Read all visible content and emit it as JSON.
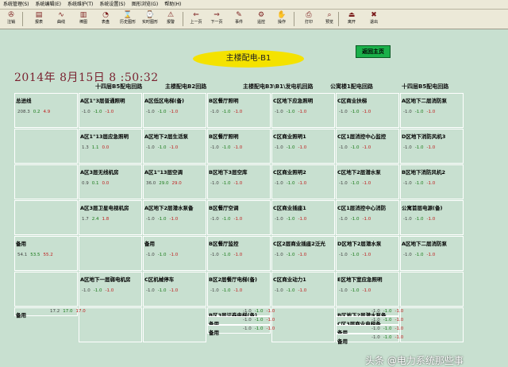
{
  "menu": [
    "系统管理(S)",
    "系统编辑(E)",
    "系统维护(T)",
    "系统设置(S)",
    "图形浏览(G)",
    "帮助(H)"
  ],
  "toolbar": [
    {
      "label": "注销",
      "icon": "logout-icon",
      "glyph": "✇"
    },
    {
      "label": "报表",
      "icon": "report-icon",
      "glyph": "▤"
    },
    {
      "label": "曲线",
      "icon": "curve-icon",
      "glyph": "∿"
    },
    {
      "label": "棒图",
      "icon": "bar-chart-icon",
      "glyph": "▥"
    },
    {
      "label": "表盘",
      "icon": "dial-icon",
      "glyph": "◔"
    },
    {
      "label": "历史图形",
      "icon": "history-graph-icon",
      "glyph": "⌛"
    },
    {
      "label": "实时图形",
      "icon": "realtime-graph-icon",
      "glyph": "⌚"
    },
    {
      "label": "报警",
      "icon": "alarm-icon",
      "glyph": "⚠"
    },
    {
      "label": "上一页",
      "icon": "prev-page-icon",
      "glyph": "⇐"
    },
    {
      "label": "下一页",
      "icon": "next-page-icon",
      "glyph": "⇒"
    },
    {
      "label": "事件",
      "icon": "event-icon",
      "glyph": "✎"
    },
    {
      "label": "遥控",
      "icon": "remote-control-icon",
      "glyph": "⚙"
    },
    {
      "label": "操作",
      "icon": "operate-icon",
      "glyph": "✋"
    },
    {
      "label": "打印",
      "icon": "print-icon",
      "glyph": "⎙"
    },
    {
      "label": "预览",
      "icon": "preview-icon",
      "glyph": "⌕"
    },
    {
      "label": "离开",
      "icon": "leave-icon",
      "glyph": "⏏"
    },
    {
      "label": "退出",
      "icon": "exit-icon",
      "glyph": "✖"
    }
  ],
  "page_title": "主楼配电-B1",
  "return_button": "返回主页",
  "datetime": "2014年 8月15日 8 :50:32",
  "column_headers": [
    "十四层B5配电回路",
    "主楼配电B2回路",
    "主楼配电B3\\B1\\发电机回路",
    "公寓楼1配电回路",
    "十四层B5配电回路"
  ],
  "cells": [
    {
      "name": "总进线",
      "vals": [
        "208.3",
        "0.2",
        "4.9"
      ]
    },
    {
      "name": "A区1\"3层普通照明",
      "vals": [
        "-1.0",
        "-1.0",
        "-1.0"
      ]
    },
    {
      "name": "A区低区电梯(备)",
      "vals": [
        "-1.0",
        "-1.0",
        "-1.0"
      ]
    },
    {
      "name": "B区餐厅照明",
      "vals": [
        "-1.0",
        "-1.0",
        "-1.0"
      ]
    },
    {
      "name": "C区地下应急照明",
      "vals": [
        "-1.0",
        "-1.0",
        "-1.0"
      ]
    },
    {
      "name": "C区商业扶梯",
      "vals": [
        "-1.0",
        "-1.0",
        "-1.0"
      ]
    },
    {
      "name": "A区地下二层消防泵",
      "vals": [
        "-1.0",
        "-1.0",
        "-1.0"
      ]
    },
    {
      "name": "A区1\"13层应急照明",
      "vals": [
        "1.3",
        "1.1",
        "0.0"
      ]
    },
    {
      "name": "A区地下2层生活泵",
      "vals": [
        "-1.0",
        "-1.0",
        "-1.0"
      ]
    },
    {
      "name": "B区餐厅照明",
      "vals": [
        "-1.0",
        "-1.0",
        "-1.0"
      ]
    },
    {
      "name": "C区商业照明1",
      "vals": [
        "-1.0",
        "-1.0",
        "-1.0"
      ]
    },
    {
      "name": "C区1层消控中心监控",
      "vals": [
        "-1.0",
        "-1.0",
        "-1.0"
      ]
    },
    {
      "name": "D区地下消防风机3",
      "vals": [
        "-1.0",
        "-1.0",
        "-1.0"
      ]
    },
    {
      "name": "A区3层无线机房",
      "vals": [
        "0.9",
        "0.1",
        "0.0"
      ]
    },
    {
      "name": "A区1\"13层空调",
      "vals": [
        "36.0",
        "29.0",
        "29.0"
      ]
    },
    {
      "name": "B区地下3层空库",
      "vals": [
        "-1.0",
        "-1.0",
        "-1.0"
      ]
    },
    {
      "name": "C区商业照明2",
      "vals": [
        "-1.0",
        "-1.0",
        "-1.0"
      ]
    },
    {
      "name": "C区地下2层潜水泵",
      "vals": [
        "-1.0",
        "-1.0",
        "-1.0"
      ]
    },
    {
      "name": "B区地下消防风机2",
      "vals": [
        "-1.0",
        "-1.0",
        "-1.0"
      ]
    },
    {
      "name": "A区3层卫星电视机房",
      "vals": [
        "1.7",
        "2.4",
        "1.8"
      ]
    },
    {
      "name": "A区地下2层潜水泵备",
      "vals": [
        "-1.0",
        "-1.0",
        "-1.0"
      ]
    },
    {
      "name": "B区餐厅空调",
      "vals": [
        "-1.0",
        "-1.0",
        "-1.0"
      ]
    },
    {
      "name": "C区商业插座1",
      "vals": [
        "-1.0",
        "-1.0",
        "-1.0"
      ]
    },
    {
      "name": "C区1层消控中心消防",
      "vals": [
        "-1.0",
        "-1.0",
        "-1.0"
      ]
    },
    {
      "name": "公寓首层电源(备)",
      "vals": [
        "-1.0",
        "-1.0",
        "-1.0"
      ]
    },
    {
      "name": "备用",
      "vals": [
        "54.1",
        "53.5",
        "55.2"
      ]
    },
    {
      "name": "备用",
      "vals": [
        "-1.0",
        "-1.0",
        "-1.0"
      ]
    },
    {
      "name": "B区餐厅监控",
      "vals": [
        "-1.0",
        "-1.0",
        "-1.0"
      ]
    },
    {
      "name": "C区2层商业插座2泛光",
      "vals": [
        "-1.0",
        "-1.0",
        "-1.0"
      ]
    },
    {
      "name": "D区地下2层潜水泵",
      "vals": [
        "-1.0",
        "-1.0",
        "-1.0"
      ]
    },
    {
      "name": "A区地下二层消防泵",
      "vals": [
        "-1.0",
        "-1.0",
        "-1.0"
      ]
    },
    {
      "name": "A区地下一层弱电机房",
      "vals": [
        "-1.0",
        "-1.0",
        "-1.0"
      ]
    },
    {
      "name": "C区机械停车",
      "vals": [
        "-1.0",
        "-1.0",
        "-1.0"
      ]
    },
    {
      "name": "B区2层餐厅电梯(备)",
      "vals": [
        "-1.0",
        "-1.0",
        "-1.0"
      ]
    },
    {
      "name": "C区商业动力1",
      "vals": [
        "-1.0",
        "-1.0",
        "-1.0"
      ]
    },
    {
      "name": "E区地下室应急照明",
      "vals": [
        "-1.0",
        "-1.0",
        "-1.0"
      ]
    },
    {
      "name": "备用",
      "vals": [
        "17.2",
        "17.0",
        "17.0"
      ]
    },
    {
      "name": "B区3层证券电梯(备)",
      "vals": [
        "-1.0",
        "-1.0",
        "-1.0"
      ]
    },
    {
      "name": "B区地下2层潜水泵备",
      "vals": [
        "-1.0",
        "-1.0",
        "-1.0"
      ]
    },
    {
      "name": "备用",
      "vals": [
        "-1.0",
        "-1.0",
        "-1.0"
      ]
    },
    {
      "name": "C区3层商业电梯备",
      "vals": [
        "-1.0",
        "-1.0",
        "-1.0"
      ]
    },
    {
      "name": "备用",
      "vals": [
        "-1.0",
        "-1.0",
        "-1.0"
      ]
    },
    {
      "name": "备用",
      "vals": [
        "-1.0",
        "-1.0",
        "-1.0"
      ]
    },
    {
      "name": "备用",
      "vals": [
        "-1.0",
        "-1.0",
        "-1.0"
      ]
    }
  ],
  "watermark": "头条 @电力系统那些事"
}
